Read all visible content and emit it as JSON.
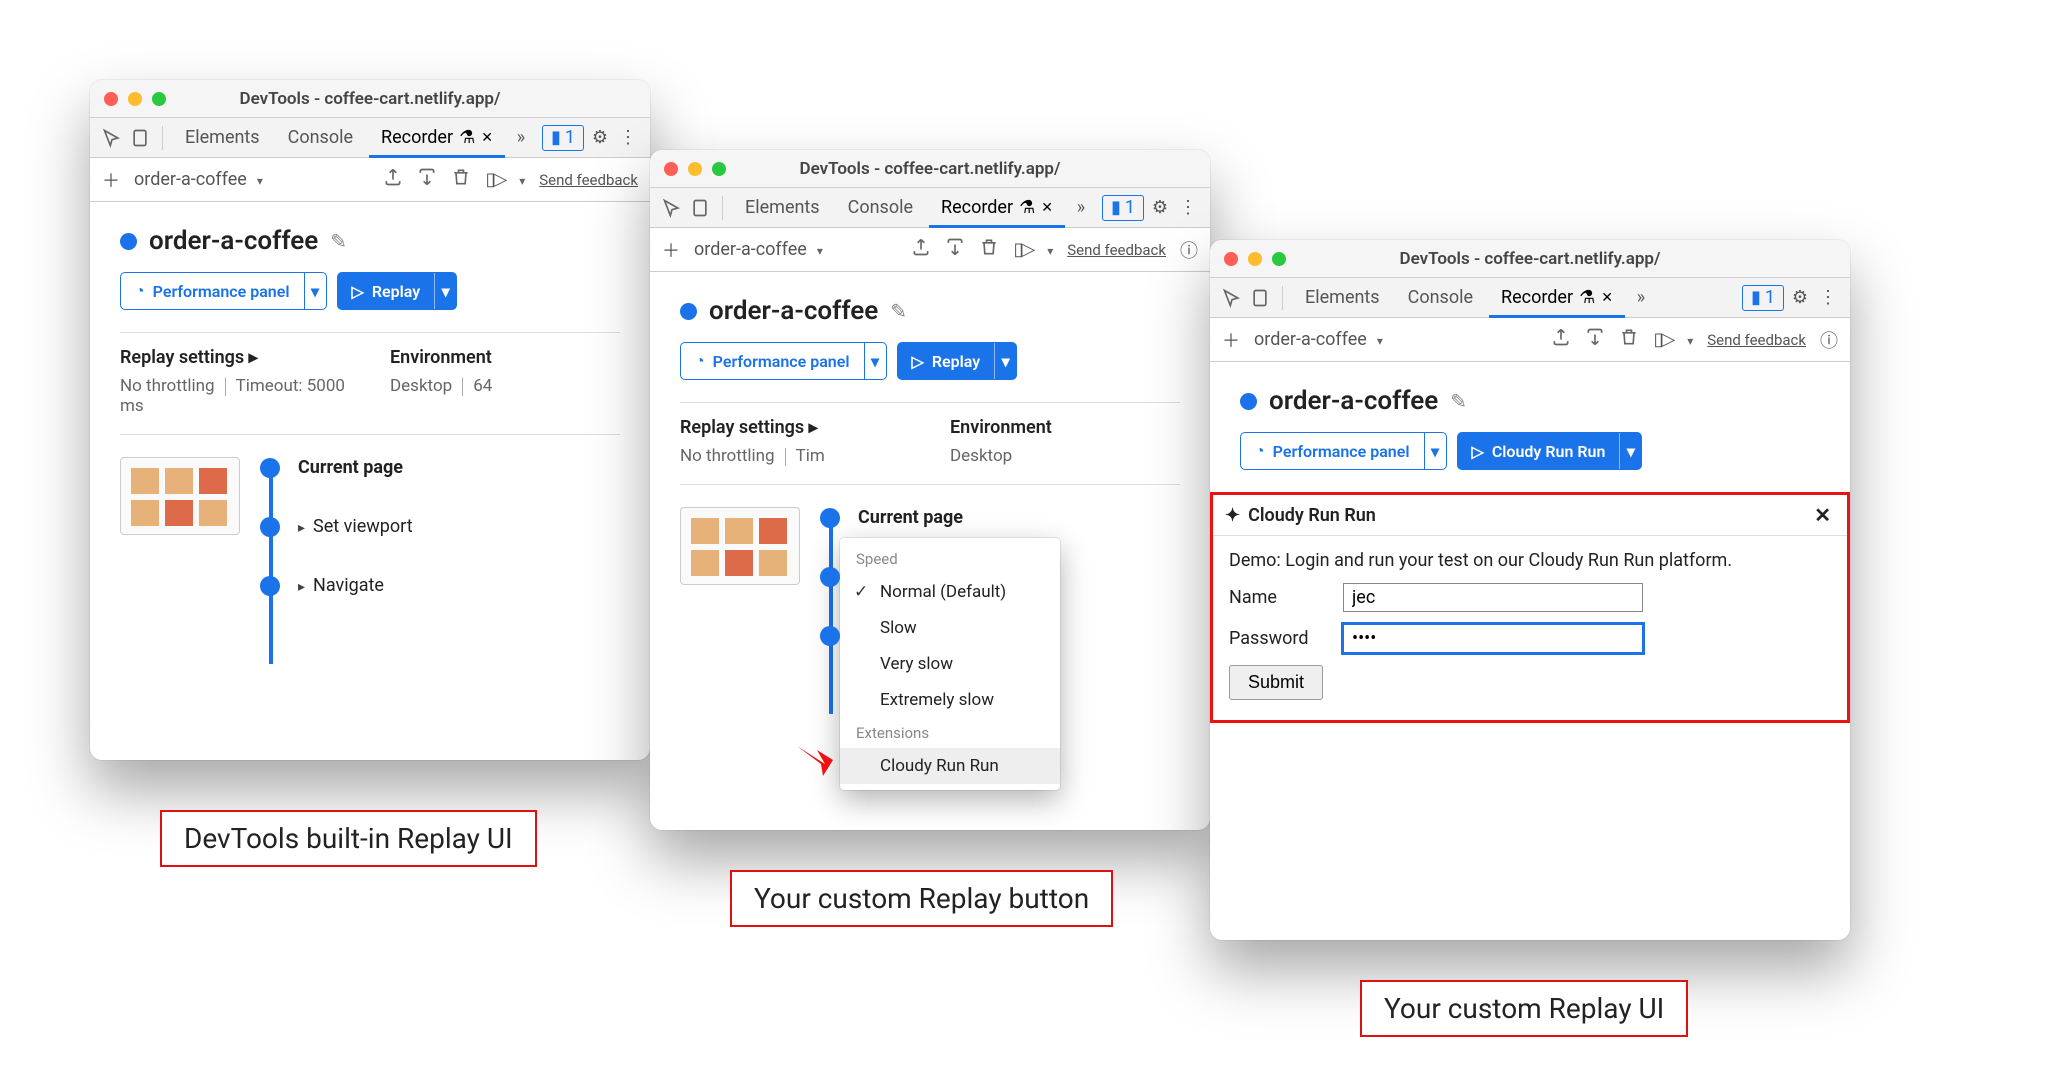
{
  "window_title": "DevTools - coffee-cart.netlify.app/",
  "tabs": {
    "elements": "Elements",
    "console": "Console",
    "recorder": "Recorder"
  },
  "issues_count": "1",
  "recorder_bar": {
    "name": "order-a-coffee",
    "feedback": "Send feedback"
  },
  "header": {
    "recording": "order-a-coffee"
  },
  "buttons": {
    "perf": "Performance panel",
    "replay": "Replay",
    "cloudy": "Cloudy Run Run"
  },
  "settings": {
    "hdr": "Replay settings ▸",
    "throttle": "No throttling",
    "timeout": "Timeout: 5000 ms",
    "env_hdr": "Environment",
    "env_val": "Desktop",
    "env_extra": "64"
  },
  "steps": {
    "s1": "Current page",
    "s2": "Set viewport",
    "s3": "Navigate"
  },
  "menu": {
    "label1": "Speed",
    "items": [
      "Normal (Default)",
      "Slow",
      "Very slow",
      "Extremely slow"
    ],
    "label2": "Extensions",
    "ext": "Cloudy Run Run"
  },
  "cloudy_panel": {
    "title": "Cloudy Run Run",
    "desc": "Demo: Login and run your test on our Cloudy Run Run platform.",
    "name_label": "Name",
    "name_val": "jec",
    "pass_label": "Password",
    "pass_val": "••••",
    "submit": "Submit"
  },
  "captions": {
    "c1": "DevTools built-in Replay UI",
    "c2": "Your custom Replay button",
    "c3": "Your custom Replay UI"
  }
}
